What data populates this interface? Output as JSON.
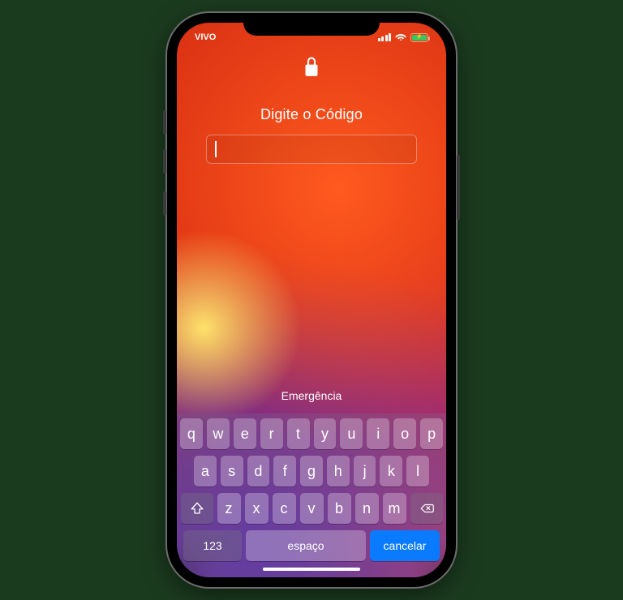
{
  "status": {
    "carrier": "VIVO"
  },
  "lock": {
    "title": "Digite o Código",
    "emergency": "Emergência"
  },
  "keyboard": {
    "row1": [
      "q",
      "w",
      "e",
      "r",
      "t",
      "y",
      "u",
      "i",
      "o",
      "p"
    ],
    "row2": [
      "a",
      "s",
      "d",
      "f",
      "g",
      "h",
      "j",
      "k",
      "l"
    ],
    "row3": [
      "z",
      "x",
      "c",
      "v",
      "b",
      "n",
      "m"
    ],
    "numbers_key": "123",
    "space_key": "espaço",
    "cancel_key": "cancelar"
  }
}
